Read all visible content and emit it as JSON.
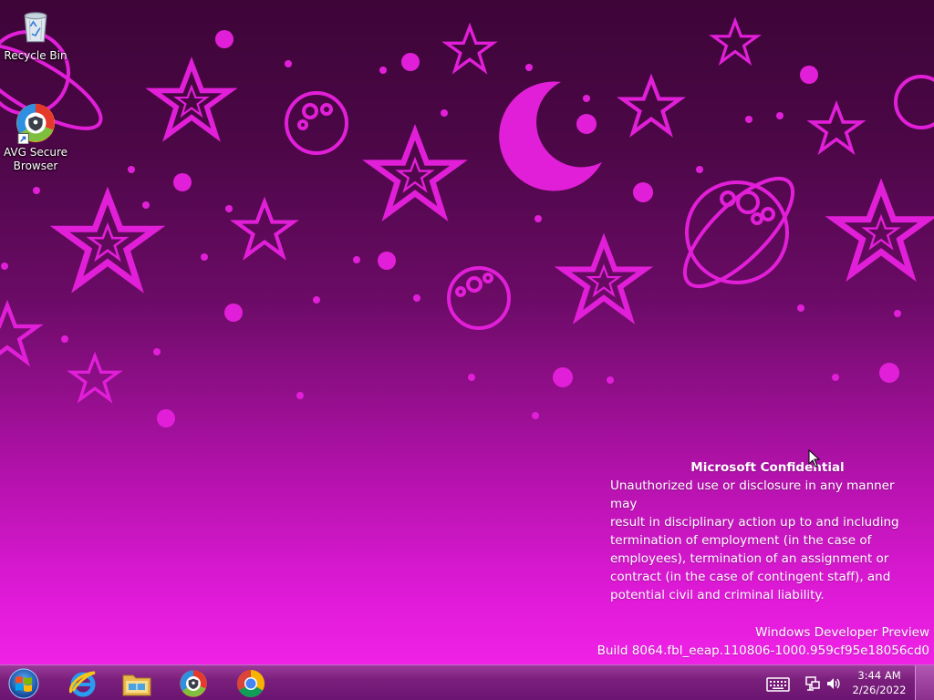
{
  "desktop": {
    "icons": [
      {
        "label": "Recycle Bin",
        "icon": "recycle-bin-icon"
      },
      {
        "label": "AVG Secure Browser",
        "icon": "avg-secure-browser-icon"
      }
    ],
    "confidential": {
      "title": "Microsoft Confidential",
      "lines": [
        "Unauthorized use or disclosure in any manner may",
        "result in disciplinary action up to and including",
        "termination of employment (in the case of",
        "employees), termination of an assignment or",
        "contract (in the case of contingent staff), and",
        "potential civil and criminal liability."
      ]
    },
    "build": {
      "line1": "Windows Developer Preview",
      "line2": "Build 8064.fbl_eeap.110806-1000.959cf95e18056cd0"
    }
  },
  "taskbar": {
    "pinned": [
      {
        "name": "internet-explorer-icon"
      },
      {
        "name": "file-explorer-icon"
      },
      {
        "name": "avg-secure-browser-icon"
      },
      {
        "name": "chrome-icon"
      }
    ],
    "tray": {
      "icons": [
        "keyboard-icon",
        "network-icon",
        "volume-icon"
      ],
      "time": "3:44 AM",
      "date": "2/26/2022"
    }
  },
  "colors": {
    "wallpaper_top": "#3d0538",
    "wallpaper_bottom": "#ef22e6",
    "wallpaper_shapes": "#e21fd8",
    "taskbar": "#7b1f7c"
  }
}
